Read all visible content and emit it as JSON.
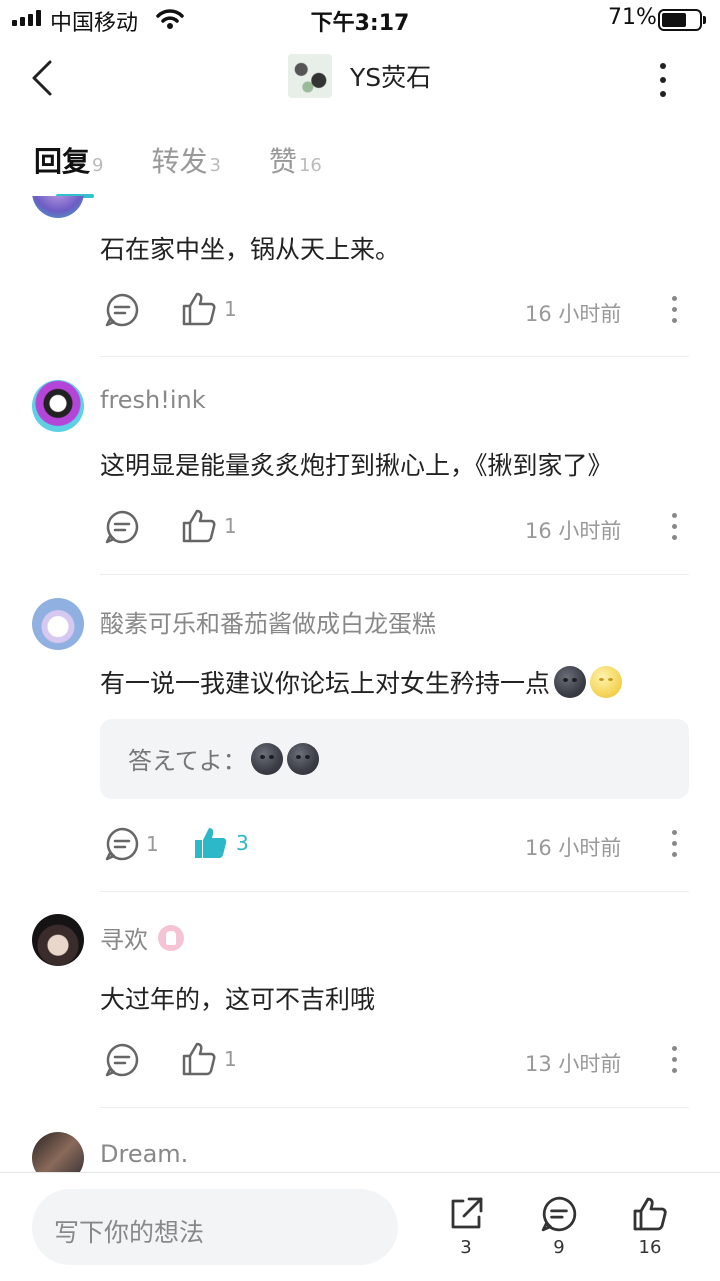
{
  "status_bar": {
    "carrier": "中国移动",
    "time": "下午3:17",
    "battery_percent": "71%",
    "battery_level": 0.71
  },
  "header": {
    "title": "YS荧石"
  },
  "tabs": [
    {
      "label": "回复",
      "count": "9",
      "active": true
    },
    {
      "label": "转发",
      "count": "3",
      "active": false
    },
    {
      "label": "赞",
      "count": "16",
      "active": false
    }
  ],
  "comments": [
    {
      "username": "",
      "content": "石在家中坐，锅从天上来。",
      "comment_count": "",
      "like_count": "1",
      "time": "16 小时前"
    },
    {
      "username": "fresh!ink",
      "content": "这明显是能量炙炙炮打到揪心上，《揪到家了》",
      "comment_count": "",
      "like_count": "1",
      "time": "16 小时前"
    },
    {
      "username": "酸素可乐和番茄酱做成白龙蛋糕",
      "content": "有一说一我建议你论坛上对女生矜持一点",
      "reply": "答えてよ：",
      "comment_count": "1",
      "like_count": "3",
      "liked": true,
      "time": "16 小时前"
    },
    {
      "username": "寻欢",
      "content": "大过年的，这可不吉利哦",
      "comment_count": "",
      "like_count": "1",
      "time": "13 小时前"
    },
    {
      "username": "Dream."
    }
  ],
  "bottom_bar": {
    "input_placeholder": "写下你的想法",
    "share_count": "3",
    "comment_count": "9",
    "like_count": "16"
  },
  "colors": {
    "accent": "#2cb8c8",
    "tab_underline": "#33c0cc"
  },
  "icons": [
    "back-icon",
    "more-icon",
    "comment-icon",
    "thumbs-up-icon",
    "share-icon",
    "wifi-icon",
    "signal-icon",
    "battery-icon"
  ]
}
